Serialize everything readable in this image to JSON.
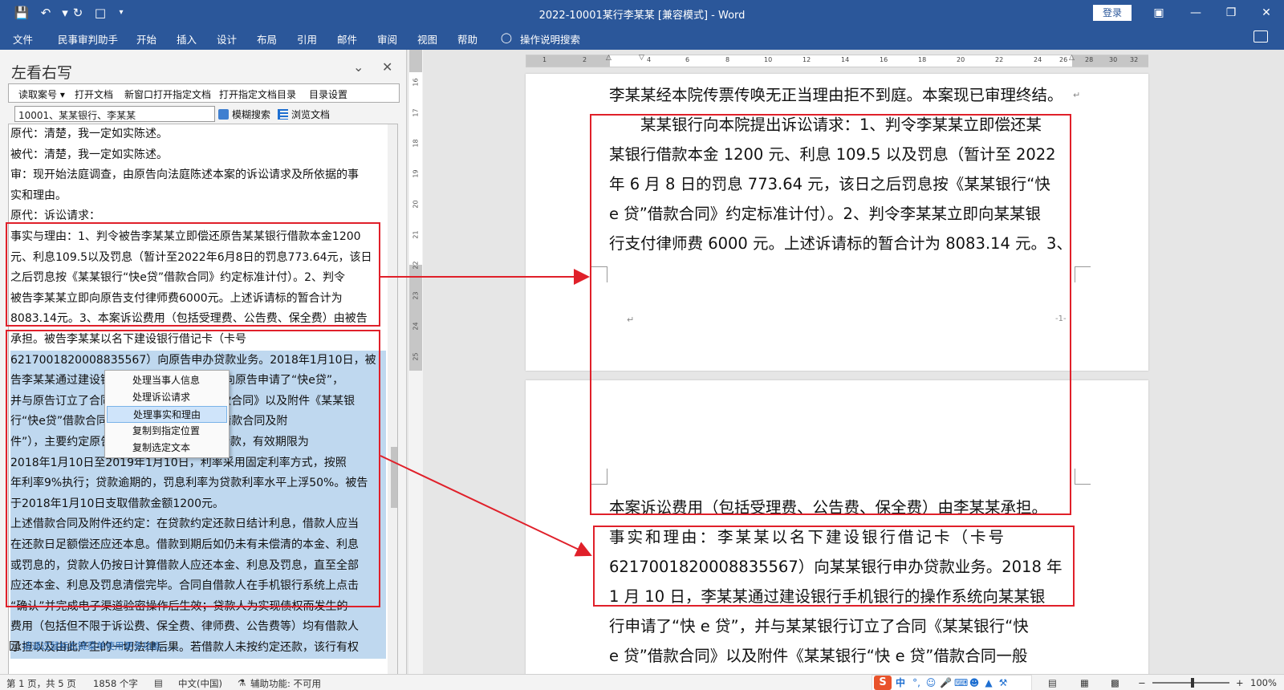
{
  "window": {
    "title": "2022-10001某行李某某 [兼容模式] - Word",
    "login_label": "登录",
    "qa_icons": [
      "save-icon",
      "undo-icon",
      "redo-icon",
      "new-document-icon",
      "customize-quick-access-icon"
    ],
    "window_buttons": [
      "ribbon-display-options-icon",
      "minimize-icon",
      "restore-icon",
      "close-icon"
    ]
  },
  "menu": [
    {
      "label": "文件"
    },
    {
      "label": "民事审判助手"
    },
    {
      "label": "开始"
    },
    {
      "label": "插入"
    },
    {
      "label": "设计"
    },
    {
      "label": "布局"
    },
    {
      "label": "引用"
    },
    {
      "label": "邮件"
    },
    {
      "label": "审阅"
    },
    {
      "label": "视图"
    },
    {
      "label": "帮助"
    },
    {
      "label": "操作说明搜索"
    }
  ],
  "left_pane": {
    "title": "左看右写",
    "toolbar": [
      "读取案号",
      "打开文档",
      "新窗口打开指定文档",
      "打开指定文档目录",
      "目录设置"
    ],
    "case_value": "10001、某某银行、李某某",
    "fuzzy_search": "模糊搜索",
    "browse_doc": "浏览文档",
    "lines": [
      "原代：清楚，我一定如实陈述。",
      "被代：清楚，我一定如实陈述。",
      "审：现开始法庭调查，由原告向法庭陈述本案的诉讼请求及所依据的事",
      "实和理由。",
      "原代：诉讼请求：",
      "事实与理由：1、判令被告李某某立即偿还原告某某银行借款本金1200",
      "元、利息109.5以及罚息（暂计至2022年6月8日的罚息773.64元，该日",
      "之后罚息按《某某银行“快e贷”借款合同》约定标准计付）。2、判令",
      "被告李某某立即向原告支付律师费6000元。上述诉请标的暂合计为",
      "8083.14元。3、本案诉讼费用（包括受理费、公告费、保全费）由被告",
      "承担。被告李某某以名下建设银行借记卡（卡号",
      "6217001820008835567）向原告申办贷款业务。2018年1月10日，被",
      "告李某某通过建设银行手机银行的操作系统向原告申请了“快e贷”，",
      "并与原告订立了合同《某某银行“快e贷”借款合同》以及附件《某某银",
      "行“快e贷”借款合同一般条款》（以下简称“借款合同及附",
      "件”），主要约定原告向被告发放1200元的借款，有效期限为",
      "2018年1月10日至2019年1月10日，利率采用固定利率方式，按照",
      "年利率9%执行；贷款逾期的，罚息利率为贷款利率水平上浮50%。被告",
      "于2018年1月10日支取借款金额1200元。",
      "上述借款合同及附件还约定：在贷款约定还款日结计利息，借款人应当",
      "在还款日足额偿还应还本息。借款到期后如仍未有未偿清的本金、利息",
      "或罚息的，贷款人仍按日计算借款人应还本金、利息及罚息，直至全部",
      "应还本金、利息及罚息清偿完毕。合同自借款人在手机银行系统上点击",
      "“确认”并完成电子渠道验密操作后生效；贷款人为实现债权而发生的",
      "费用（包括但不限于诉讼费、保全费、律师费、公告费等）均有借款人",
      "承担以及由此产生的一切法律后果。若借款人未按约定还款，该行有权"
    ],
    "hint": "请通过鼠标右键菜单使用更多功能......"
  },
  "context_menu": [
    {
      "label": "处理当事人信息"
    },
    {
      "label": "处理诉讼请求"
    },
    {
      "label": "处理事实和理由"
    },
    {
      "label": "复制到指定位置"
    },
    {
      "label": "复制选定文本"
    }
  ],
  "ruler": {
    "h_ticks": [
      "1",
      "2",
      "4",
      "6",
      "8",
      "10",
      "12",
      "14",
      "16",
      "18",
      "20",
      "22",
      "24",
      "26",
      "28",
      "30",
      "32"
    ],
    "v_ticks": [
      "16",
      "17",
      "18",
      "19",
      "20",
      "21",
      "22",
      "23",
      "24",
      "25"
    ]
  },
  "document": {
    "page1_lines": [
      "李某某经本院传票传唤无正当理由拒不到庭。本案现已审理终结。",
      "　　某某银行向本院提出诉讼请求：1、判令李某某立即偿还某",
      "某银行借款本金 1200 元、利息 109.5 以及罚息（暂计至 2022",
      "年 6 月 8 日的罚息 773.64 元，该日之后罚息按《某某银行“快",
      "e 贷”借款合同》约定标准计付）。2、判令李某某立即向某某银",
      "行支付律师费 6000 元。上述诉请标的暂合计为 8083.14 元。3、"
    ],
    "page_number": "-1-",
    "page2_lines": [
      "本案诉讼费用（包括受理费、公告费、保全费）由李某某承担。",
      "事实和理由：李某某以名下建设银行借记卡（卡号",
      "6217001820008835567）向某某银行申办贷款业务。2018 年",
      "1 月 10 日，李某某通过建设银行手机银行的操作系统向某某银",
      "行申请了“快 e 贷”，并与某某银行订立了合同《某某银行“快",
      "e 贷”借款合同》以及附件《某某银行“快 e 贷”借款合同一般"
    ]
  },
  "status": {
    "page": "第 1 页，共 5 页",
    "words": "1858 个字",
    "language": "中文(中国)",
    "accessibility": "辅助功能: 不可用",
    "ime_logo": "S",
    "ime_mode": "中",
    "zoom": "100%"
  },
  "colors": {
    "accent": "#2b579a",
    "annotation_red": "#e0202a",
    "selection": "#bfd8ef"
  }
}
